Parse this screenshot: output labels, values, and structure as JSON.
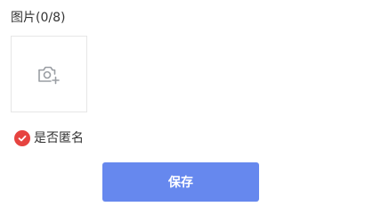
{
  "photos": {
    "label": "图片(0/8)",
    "upload_icon": "camera-plus-icon",
    "icon_color": "#9a9ea3"
  },
  "anonymous": {
    "label": "是否匿名",
    "checked": true,
    "check_icon": "check-circle-icon",
    "check_color": "#e64340"
  },
  "save": {
    "label": "保存",
    "color": "#6688ee"
  }
}
